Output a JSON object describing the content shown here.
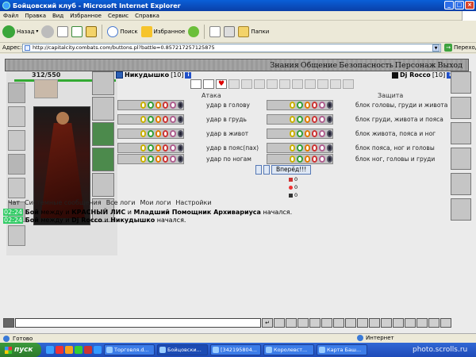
{
  "window": {
    "title": "Бойцовский клуб - Microsoft Internet Explorer"
  },
  "menu": [
    "Файл",
    "Правка",
    "Вид",
    "Избранное",
    "Сервис",
    "Справка"
  ],
  "toolbar": {
    "back": "Назад",
    "search": "Поиск",
    "favorites": "Избранное",
    "folders": "Папки"
  },
  "address": {
    "label": "Адрес:",
    "url": "http://capitalcity.combats.com/buttons.pl?battle=0.857217257125875",
    "go": "Переход"
  },
  "topmenu": [
    "Знания",
    "Общение",
    "Безопасность",
    "Персонаж",
    "Выход"
  ],
  "player": {
    "hp": "312/550",
    "name": "Никудышко",
    "level": "[10]"
  },
  "opponent": {
    "name": "Dj Rocco",
    "level": "[10]"
  },
  "fight": {
    "attack_title": "Атака",
    "defense_title": "Защита",
    "attack": [
      "удар в голову",
      "удар в грудь",
      "удар в живот",
      "удар в пояс(пах)",
      "удар по ногам"
    ],
    "defense": [
      "блок головы, груди и живота",
      "блок груди, живота и пояса",
      "блок живота, пояса и ног",
      "блок пояса, ног и головы",
      "блок ног, головы и груди"
    ],
    "forward": "Вперёд!!!",
    "counters": [
      "0",
      "0",
      "0"
    ]
  },
  "log_tabs": [
    "Чат",
    "Системные сообщения",
    "Все логи",
    "Мои логи",
    "Настройки"
  ],
  "log": [
    {
      "time": "02:24",
      "pre": "Бой",
      "t1": " между и ",
      "a": "КРАСНЫЙ ЛИС",
      "t2": " и ",
      "b": "Младший Помощник Архивариуса",
      "t3": " начался."
    },
    {
      "time": "02:24",
      "pre": "Бой",
      "t1": " между и ",
      "a": "Dj Rocco",
      "t2": " и ",
      "b": "Никудышко",
      "t3": " начался."
    }
  ],
  "status": {
    "left": "Готово",
    "zone": "Интернет"
  },
  "taskbar": {
    "start": "пуск",
    "tasks": [
      "Торговля.d...",
      "Бойцовски...",
      "[342195804...",
      "Королевст...",
      "Карта Баш..."
    ]
  },
  "watermark": "photo.scrolls.ru",
  "colors": {
    "xp_blue": "#0a4fd0",
    "time_green": "#33cc66",
    "start_green": "#3c9a3c"
  }
}
